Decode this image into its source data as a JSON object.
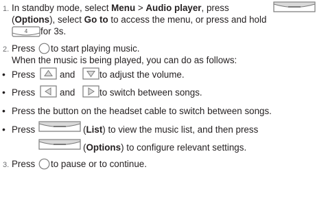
{
  "steps": [
    {
      "number": "1.",
      "parts": {
        "a": "In standby mode, select ",
        "menu": "Menu",
        "sep": " > ",
        "audio": "Audio player",
        "b": ", press",
        "options_open": "(",
        "options": "Options",
        "c": "), select ",
        "goto": "Go to",
        "d": " to access the menu, or press and hold",
        "e": " for 3s."
      }
    },
    {
      "number": "2.",
      "line1": {
        "a": "Press ",
        "b": " to start playing music."
      },
      "line2": "When the music is being played, you can do as follows:"
    },
    {
      "number": "3.",
      "line1": {
        "a": "Press ",
        "b": " to pause or to continue."
      }
    }
  ],
  "bullets": [
    {
      "a": "Press ",
      "and": " and ",
      "b": " to adjust the volume."
    },
    {
      "a": "Press ",
      "and": " and ",
      "b": " to switch between songs."
    },
    {
      "text": "Press the button on the headset cable to switch between songs."
    },
    {
      "a": "Press ",
      "list_open": " (",
      "list": "List",
      "list_close": ") to view the music list, and then press",
      "options_open": " (",
      "options": "Options",
      "options_close": ") to configure relevant settings."
    }
  ],
  "bullet_char": "•",
  "icons": {
    "softkey": "softkey-icon",
    "hold_key": "number-4-key-icon",
    "circle": "circle-key-icon",
    "up": "up-arrow-key-icon",
    "down": "down-arrow-key-icon",
    "left": "left-arrow-key-icon",
    "right": "right-arrow-key-icon"
  },
  "colors": {
    "text": "#231f20",
    "number": "#6d6e71",
    "icon_stroke": "#7a7a7a",
    "icon_fill": "#d9d9d9"
  }
}
